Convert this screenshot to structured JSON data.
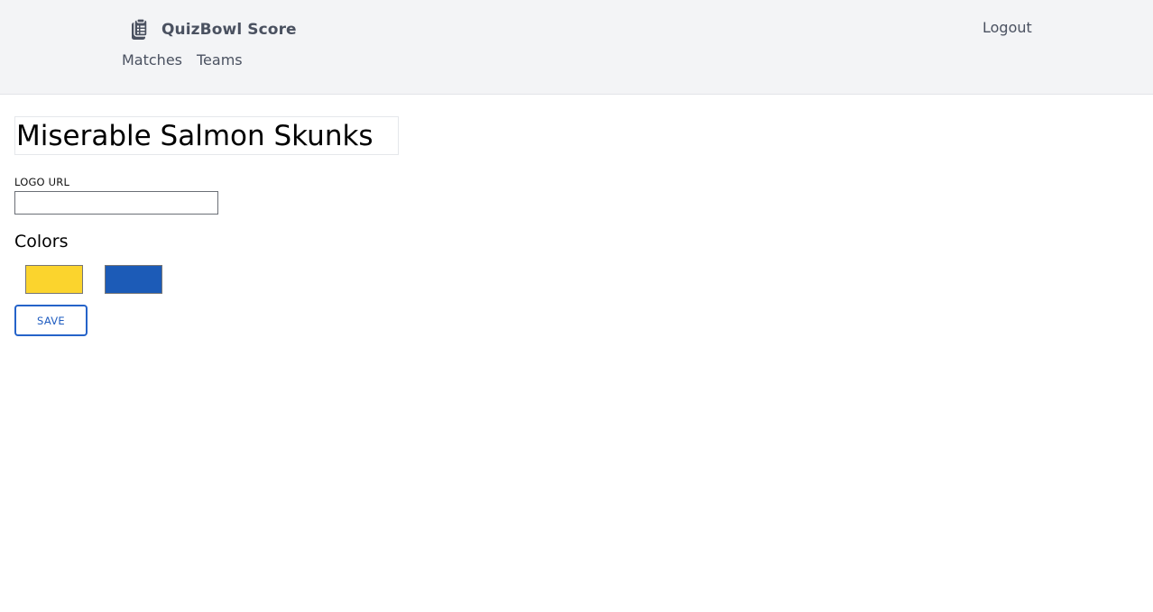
{
  "header": {
    "brand_title": "QuizBowl Score",
    "brand_icon": "clipboard-list-icon",
    "logout_label": "Logout",
    "nav": [
      {
        "label": "Matches"
      },
      {
        "label": "Teams"
      }
    ]
  },
  "team": {
    "name": "Miserable Salmon Skunks",
    "logo_label": "LOGO URL",
    "logo_value": "",
    "colors_heading": "Colors",
    "colors": [
      "#fbd42d",
      "#1c5bb7"
    ],
    "save_label": "SAVE"
  },
  "theme": {
    "header_bg": "#f3f4f6",
    "nav_text": "#4a5160",
    "accent": "#2563c9"
  }
}
